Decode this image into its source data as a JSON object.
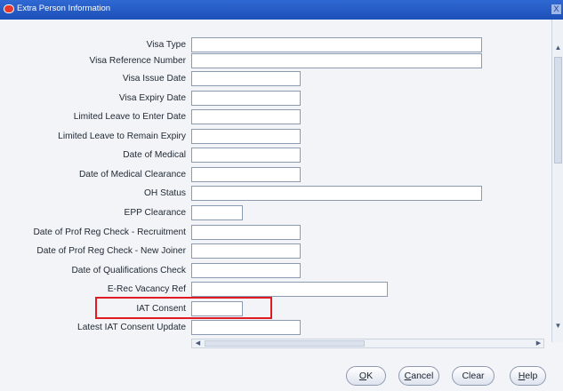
{
  "window": {
    "title": "Extra Person Information",
    "close_glyph": "X"
  },
  "fields": [
    {
      "label": "Visa Type",
      "value": ""
    },
    {
      "label": "Visa Reference Number",
      "value": ""
    },
    {
      "label": "Visa Issue Date",
      "value": ""
    },
    {
      "label": "Visa Expiry Date",
      "value": ""
    },
    {
      "label": "Limited Leave to Enter Date",
      "value": ""
    },
    {
      "label": "Limited Leave to Remain Expiry",
      "value": ""
    },
    {
      "label": "Date of Medical",
      "value": ""
    },
    {
      "label": "Date of Medical Clearance",
      "value": ""
    },
    {
      "label": "OH Status",
      "value": ""
    },
    {
      "label": "EPP Clearance",
      "value": ""
    },
    {
      "label": "Date of Prof Reg Check - Recruitment",
      "value": ""
    },
    {
      "label": "Date of Prof Reg Check - New Joiner",
      "value": ""
    },
    {
      "label": "Date of Qualifications Check",
      "value": ""
    },
    {
      "label": "E-Rec Vacancy Ref",
      "value": ""
    },
    {
      "label": "IAT Consent",
      "value": ""
    },
    {
      "label": "Latest IAT Consent Update",
      "value": ""
    }
  ],
  "highlighted_field": "IAT Consent",
  "buttons": {
    "ok": {
      "mnemonic": "O",
      "rest": "K"
    },
    "cancel": {
      "mnemonic": "C",
      "rest": "ancel"
    },
    "clear": {
      "label": "Clear"
    },
    "help": {
      "mnemonic": "H",
      "rest": "elp"
    }
  },
  "colors": {
    "title_bar": "#1d4fb8",
    "highlight": "#e01b24",
    "panel_bg": "#f2f4f8"
  }
}
